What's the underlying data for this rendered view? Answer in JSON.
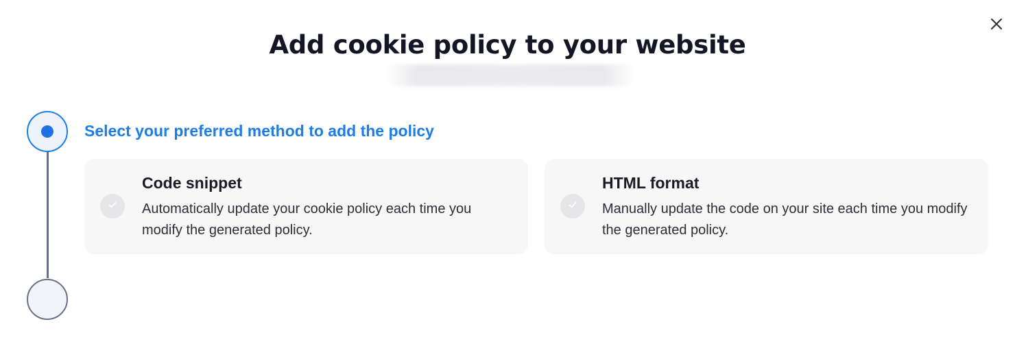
{
  "dialog": {
    "title": "Add cookie policy to your website",
    "close_icon": "close-icon"
  },
  "stepper": {
    "steps": [
      {
        "state": "active",
        "label": "Select your preferred method to add the policy"
      },
      {
        "state": "pending"
      }
    ]
  },
  "options": [
    {
      "title": "Code snippet",
      "description": "Automatically update your cookie policy each time you modify the generated policy.",
      "icon": "check-icon"
    },
    {
      "title": "HTML format",
      "description": "Manually update the code on your site each time you modify the generated policy.",
      "icon": "check-icon"
    }
  ],
  "colors": {
    "accent": "#1c7ce8",
    "card_bg": "#f7f7f8",
    "stepper_line": "#6b7088"
  }
}
